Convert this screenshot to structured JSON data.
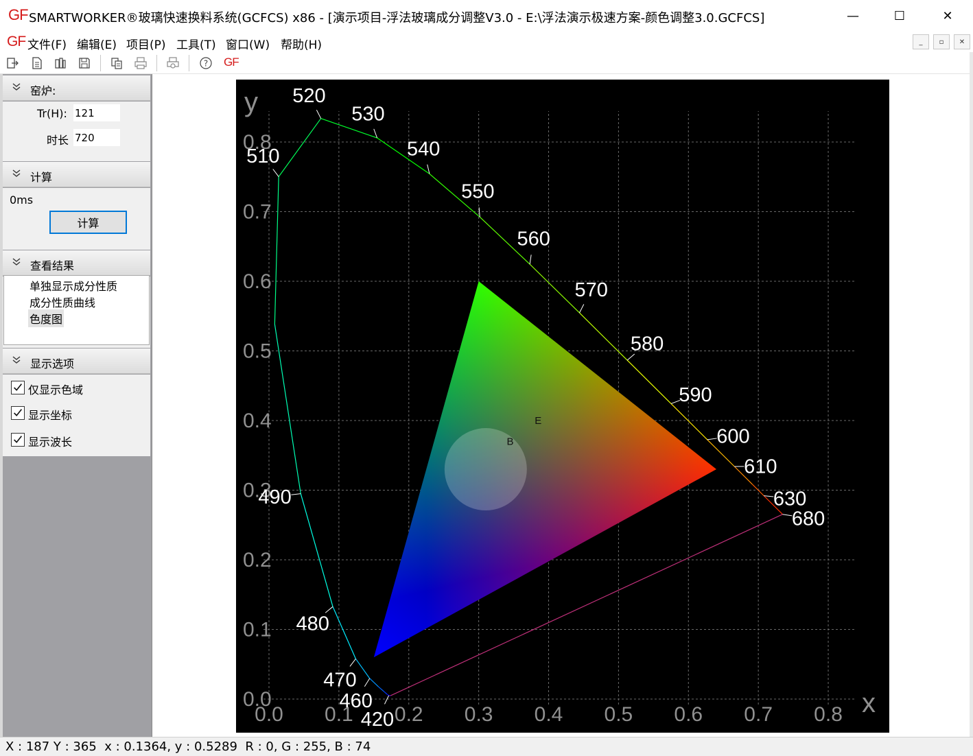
{
  "window": {
    "logo": "GF",
    "title": "SMARTWORKER®玻璃快速换料系统(GCFCS) x86  - [演示项目-浮法玻璃成分调整V3.0 - E:\\浮法演示极速方案-颜色调整3.0.GCFCS]",
    "min_glyph": "—",
    "max_glyph": "☐",
    "close_glyph": "✕"
  },
  "menu": {
    "logo": "GF",
    "items": [
      "文件(F)",
      "编辑(E)",
      "项目(P)",
      "工具(T)",
      "窗口(W)",
      "帮助(H)"
    ],
    "mdi_buttons": [
      "_",
      "▫",
      "✕"
    ]
  },
  "toolbar": {
    "icons": [
      "exit-icon",
      "new-doc-icon",
      "open-icon",
      "save-icon",
      "export-icon",
      "print-icon",
      "print-preview-icon",
      "help-icon",
      "gf-logo-icon"
    ],
    "gf_label": "GF"
  },
  "panel": {
    "kiln": {
      "header": "窑炉:",
      "tr_label": "Tr(H):",
      "tr_value": "121",
      "duration_label": "时长",
      "duration_value": "720"
    },
    "calc": {
      "header": "计算",
      "elapsed": "0ms",
      "button": "计算"
    },
    "results": {
      "header": "查看结果",
      "items": [
        "单独显示成分性质",
        "成分性质曲线",
        "色度图"
      ],
      "selected_index": 2
    },
    "options": {
      "header": "显示选项",
      "items": [
        {
          "label": "仅显示色域",
          "checked": true
        },
        {
          "label": "显示坐标",
          "checked": true
        },
        {
          "label": "显示波长",
          "checked": true
        }
      ]
    }
  },
  "status": {
    "text": "X : 187 Y : 365  x : 0.1364, y : 0.5289  R : 0, G : 255, B : 74"
  },
  "chart_data": {
    "type": "scatter",
    "title": "",
    "xlabel": "x",
    "ylabel": "y",
    "xlim": [
      0.0,
      0.8
    ],
    "ylim": [
      0.0,
      0.8
    ],
    "xticks": [
      "0.0",
      "0.1",
      "0.2",
      "0.3",
      "0.4",
      "0.5",
      "0.6",
      "0.7",
      "0.8"
    ],
    "yticks": [
      "0.0",
      "0.1",
      "0.2",
      "0.3",
      "0.4",
      "0.5",
      "0.6",
      "0.7",
      "0.8"
    ],
    "grid": true,
    "background": "#000000",
    "locus": [
      [
        0.1741,
        0.005
      ],
      [
        0.1726,
        0.0048
      ],
      [
        0.1714,
        0.0051
      ],
      [
        0.1689,
        0.0069
      ],
      [
        0.1644,
        0.0109
      ],
      [
        0.1566,
        0.0177
      ],
      [
        0.144,
        0.0297
      ],
      [
        0.1241,
        0.0578
      ],
      [
        0.0913,
        0.1327
      ],
      [
        0.0454,
        0.295
      ],
      [
        0.0082,
        0.5384
      ],
      [
        0.0139,
        0.7502
      ],
      [
        0.0743,
        0.8338
      ],
      [
        0.1547,
        0.8059
      ],
      [
        0.2296,
        0.7543
      ],
      [
        0.3016,
        0.6923
      ],
      [
        0.3731,
        0.6245
      ],
      [
        0.4441,
        0.5547
      ],
      [
        0.5125,
        0.4866
      ],
      [
        0.5752,
        0.4242
      ],
      [
        0.627,
        0.3725
      ],
      [
        0.6658,
        0.334
      ],
      [
        0.6915,
        0.3083
      ],
      [
        0.7079,
        0.292
      ],
      [
        0.7347,
        0.2653
      ]
    ],
    "wavelength_labels": [
      {
        "nm": "420",
        "x": 0.1714,
        "y": 0.0051
      },
      {
        "nm": "460",
        "x": 0.144,
        "y": 0.0297
      },
      {
        "nm": "470",
        "x": 0.1241,
        "y": 0.0578
      },
      {
        "nm": "480",
        "x": 0.0913,
        "y": 0.1327
      },
      {
        "nm": "490",
        "x": 0.0454,
        "y": 0.295
      },
      {
        "nm": "510",
        "x": 0.0139,
        "y": 0.7502
      },
      {
        "nm": "520",
        "x": 0.0743,
        "y": 0.8338
      },
      {
        "nm": "530",
        "x": 0.1547,
        "y": 0.8059
      },
      {
        "nm": "540",
        "x": 0.2296,
        "y": 0.7543
      },
      {
        "nm": "550",
        "x": 0.3016,
        "y": 0.6923
      },
      {
        "nm": "560",
        "x": 0.3731,
        "y": 0.6245
      },
      {
        "nm": "570",
        "x": 0.4441,
        "y": 0.5547
      },
      {
        "nm": "580",
        "x": 0.5125,
        "y": 0.4866
      },
      {
        "nm": "590",
        "x": 0.5752,
        "y": 0.4242
      },
      {
        "nm": "600",
        "x": 0.627,
        "y": 0.3725
      },
      {
        "nm": "610",
        "x": 0.6658,
        "y": 0.334
      },
      {
        "nm": "630",
        "x": 0.7079,
        "y": 0.292
      },
      {
        "nm": "680",
        "x": 0.7347,
        "y": 0.2653
      }
    ],
    "gamut": {
      "red": [
        0.64,
        0.33
      ],
      "green": [
        0.3,
        0.6
      ],
      "blue": [
        0.15,
        0.06
      ]
    },
    "points": [
      {
        "label": "E",
        "x": 0.385,
        "y": 0.395
      },
      {
        "label": "B",
        "x": 0.345,
        "y": 0.365
      }
    ]
  }
}
